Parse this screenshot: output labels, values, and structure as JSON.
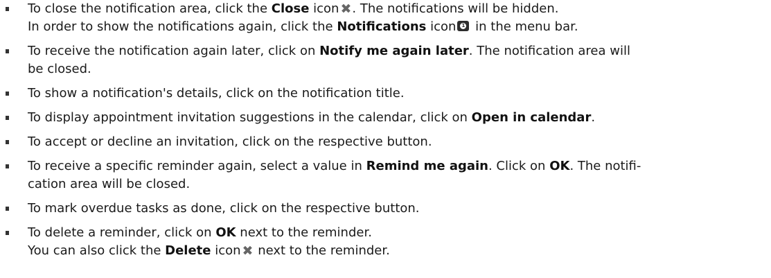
{
  "items": [
    {
      "l1_a": "To close the notification area, click the ",
      "l1_b": "Close",
      "l1_c": " icon",
      "l1_icon": "close-x-icon",
      "l1_d": ". The notifications will be hidden.",
      "l2_a": "In order to show the notifications again, click the ",
      "l2_b": "Notifications",
      "l2_c": " icon",
      "l2_icon": "notifications-badge-icon",
      "l2_badge": "1",
      "l2_d": " in the menu bar."
    },
    {
      "l1_a": "To receive the notification again later, click on ",
      "l1_b": "Notify me again later",
      "l1_c": ". The notification area will",
      "l2": "be closed."
    },
    {
      "l1": "To show a notification's details, click on the notification title."
    },
    {
      "l1_a": "To display appointment invitation suggestions in the calendar, click on ",
      "l1_b": "Open in calendar",
      "l1_c": "."
    },
    {
      "l1": "To accept or decline an invitation, click on the respective button."
    },
    {
      "l1_a": "To receive a specific reminder again, select a value in ",
      "l1_b": "Remind me again",
      "l1_c": ". Click on ",
      "l1_d": "OK",
      "l1_e": ". The notifi-",
      "l2": "cation area will be closed."
    },
    {
      "l1": "To mark overdue tasks as done, click on the respective button."
    },
    {
      "l1_a": "To delete a reminder, click on ",
      "l1_b": "OK",
      "l1_c": " next to the reminder.",
      "l2_a": "You can also click the ",
      "l2_b": "Delete",
      "l2_c": " icon",
      "l2_icon": "delete-x-icon",
      "l2_d": " next to the reminder."
    }
  ]
}
